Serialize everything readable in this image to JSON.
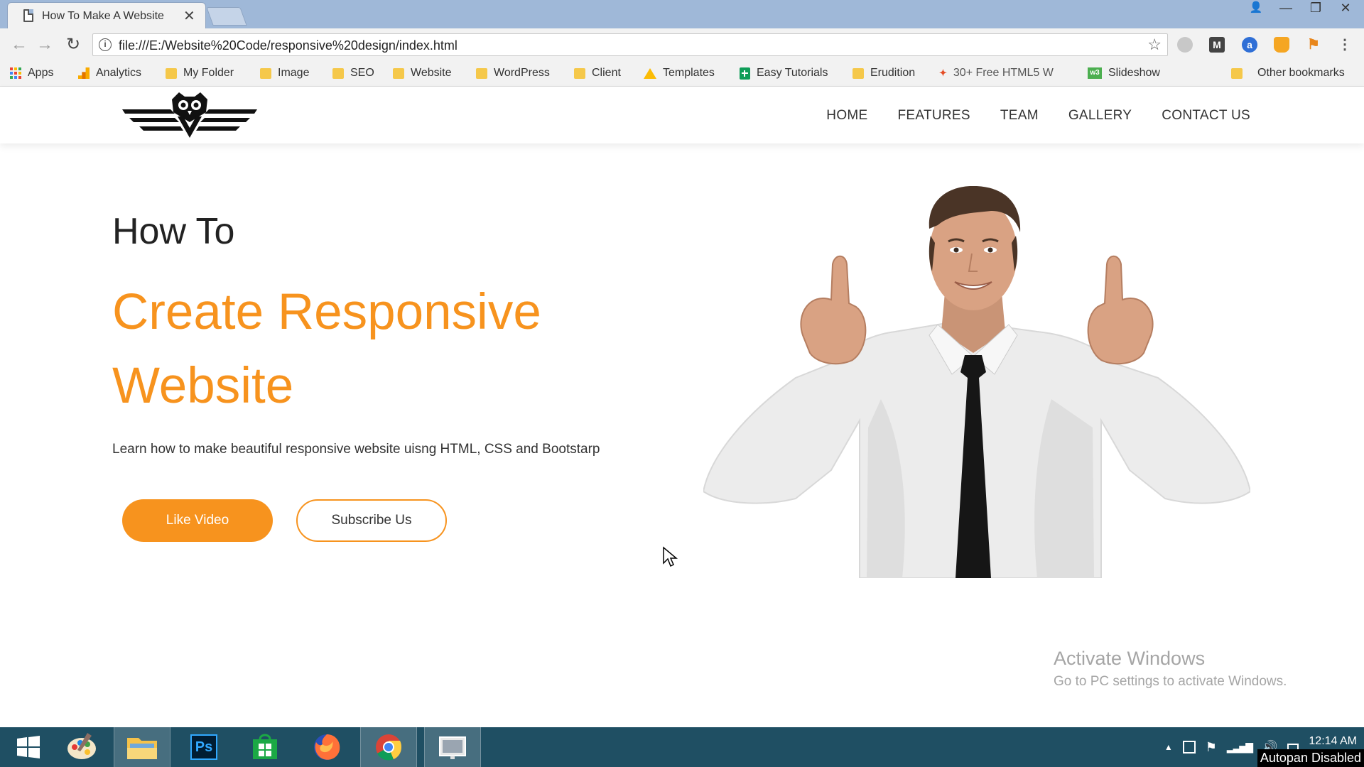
{
  "browser": {
    "tab_title": "How To Make A Website",
    "close_glyph": "✕",
    "url": "file:///E:/Website%20Code/responsive%20design/index.html",
    "window_controls": [
      "—",
      "❐",
      "✕"
    ]
  },
  "bookmarks": [
    {
      "label": "Apps",
      "icon": "apps-icon"
    },
    {
      "label": "Analytics",
      "icon": "analytics-icon"
    },
    {
      "label": "My Folder",
      "icon": "folder-icon"
    },
    {
      "label": "Image",
      "icon": "folder-icon"
    },
    {
      "label": "SEO",
      "icon": "folder-icon"
    },
    {
      "label": "Website",
      "icon": "folder-icon"
    },
    {
      "label": "WordPress",
      "icon": "folder-icon"
    },
    {
      "label": "Client",
      "icon": "folder-icon"
    },
    {
      "label": "Templates",
      "icon": "drive-icon"
    },
    {
      "label": "Easy Tutorials",
      "icon": "sheets-icon"
    },
    {
      "label": "Erudition",
      "icon": "folder-icon"
    },
    {
      "label": "30+ Free HTML5 W",
      "icon": "html5-icon"
    },
    {
      "label": "Slideshow",
      "icon": "w3-icon"
    },
    {
      "label": "Other bookmarks",
      "icon": "folder-icon"
    }
  ],
  "site": {
    "nav": [
      "HOME",
      "FEATURES",
      "TEAM",
      "GALLERY",
      "CONTACT US"
    ],
    "hero": {
      "small_heading": "How To",
      "big_heading_line1": "Create Responsive",
      "big_heading_line2": "Website",
      "description": "Learn how to make beautiful responsive website uisng HTML, CSS and Bootstarp",
      "primary_button": "Like Video",
      "secondary_button": "Subscribe Us"
    },
    "accent_color": "#f7931e"
  },
  "watermark": {
    "line1": "Activate Windows",
    "line2": "Go to PC settings to activate Windows."
  },
  "taskbar": {
    "apps": [
      "windows-start-icon",
      "paint-icon",
      "file-explorer-icon",
      "photoshop-icon",
      "store-icon",
      "firefox-icon",
      "chrome-icon",
      "presentation-icon"
    ],
    "photoshop_label": "Ps",
    "clock": "12:14 AM",
    "autopan": "Autopan Disabled"
  }
}
